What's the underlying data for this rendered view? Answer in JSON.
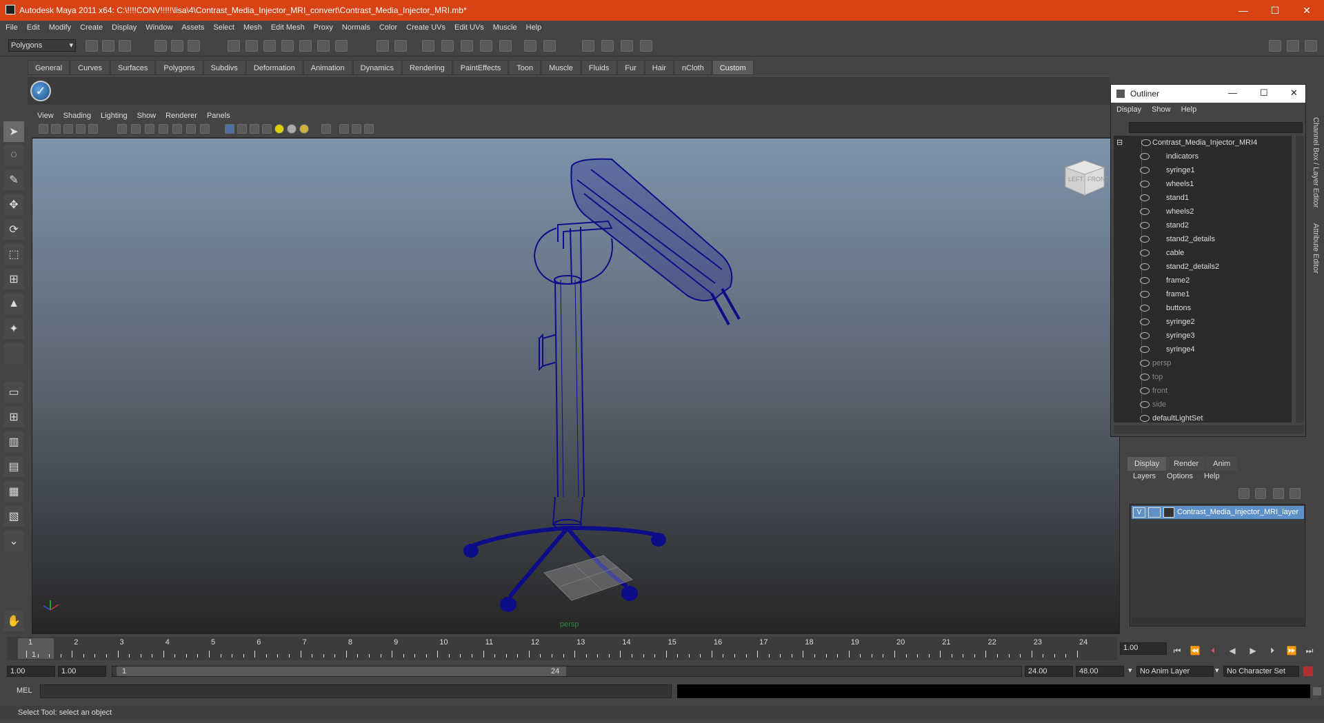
{
  "window": {
    "title": "Autodesk Maya 2011 x64: C:\\!!!!CONV!!!!!\\lisa\\4\\Contrast_Media_Injector_MRI_convert\\Contrast_Media_Injector_MRI.mb*",
    "minimize": "—",
    "maximize": "☐",
    "close": "✕"
  },
  "menubar": [
    "File",
    "Edit",
    "Modify",
    "Create",
    "Display",
    "Window",
    "Assets",
    "Select",
    "Mesh",
    "Edit Mesh",
    "Proxy",
    "Normals",
    "Color",
    "Create UVs",
    "Edit UVs",
    "Muscle",
    "Help"
  ],
  "toolbar": {
    "mode": "Polygons"
  },
  "shelf": {
    "tabs": [
      "General",
      "Curves",
      "Surfaces",
      "Polygons",
      "Subdivs",
      "Deformation",
      "Animation",
      "Dynamics",
      "Rendering",
      "PaintEffects",
      "Toon",
      "Muscle",
      "Fluids",
      "Fur",
      "Hair",
      "nCloth",
      "Custom"
    ],
    "active": "Custom"
  },
  "viewport": {
    "menu": [
      "View",
      "Shading",
      "Lighting",
      "Show",
      "Renderer",
      "Panels"
    ],
    "camera_label": "persp",
    "viewcube": {
      "left": "LEFT",
      "front": "FRONT"
    }
  },
  "outliner": {
    "title": "Outliner",
    "menu": [
      "Display",
      "Show",
      "Help"
    ],
    "root": "Contrast_Media_Injector_MRI4",
    "children": [
      "indicators",
      "syringe1",
      "wheels1",
      "stand1",
      "wheels2",
      "stand2",
      "stand2_details",
      "cable",
      "stand2_details2",
      "frame2",
      "frame1",
      "buttons",
      "syringe2",
      "syringe3",
      "syringe4"
    ],
    "cameras": [
      "persp",
      "top",
      "front",
      "side"
    ],
    "sets": [
      "defaultLightSet"
    ]
  },
  "channel_box": {
    "tabs": [
      "Display",
      "Render",
      "Anim"
    ],
    "active": "Display",
    "layer_menu": [
      "Layers",
      "Options",
      "Help"
    ],
    "layer": {
      "visible": "V",
      "name": "Contrast_Media_Injector_MRI_layer"
    },
    "dock_labels": [
      "Channel Box / Layer Editor",
      "Attribute Editor"
    ]
  },
  "timeline": {
    "ticks": [
      "1",
      "2",
      "3",
      "4",
      "5",
      "6",
      "7",
      "8",
      "9",
      "10",
      "11",
      "12",
      "13",
      "14",
      "15",
      "16",
      "17",
      "18",
      "19",
      "20",
      "21",
      "22",
      "23",
      "24"
    ],
    "current_frame_marker": "1",
    "current_time": "1.00"
  },
  "range": {
    "start": "1.00",
    "playback_start": "1.00",
    "slider_start": "1",
    "slider_end": "24",
    "playback_end": "24.00",
    "end": "48.00",
    "anim_layer": "No Anim Layer",
    "character_set": "No Character Set"
  },
  "command": {
    "label": "MEL"
  },
  "status": {
    "text": "Select Tool: select an object"
  },
  "colors": {
    "titlebar": "#d84315",
    "wireframe": "#0d0d8a",
    "layer_highlight": "#5d8fc8"
  }
}
